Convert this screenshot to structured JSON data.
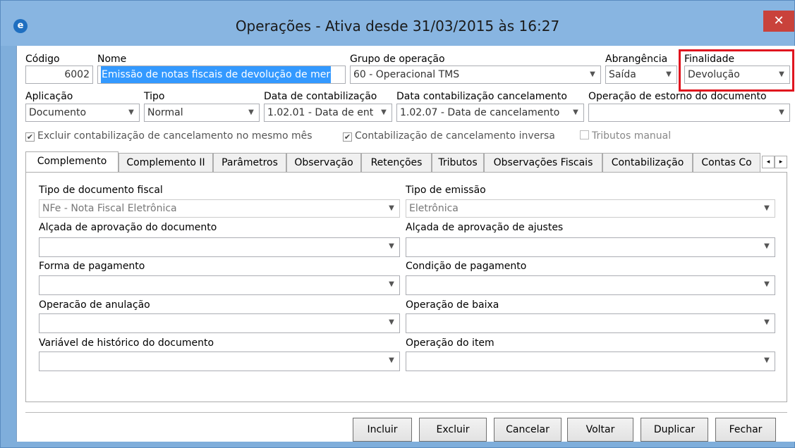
{
  "window": {
    "title": "Operações - Ativa desde 31/03/2015 às 16:27",
    "app_icon_glyph": "e",
    "close_glyph": "✕"
  },
  "header": {
    "codigo": {
      "label": "Código",
      "value": "6002"
    },
    "nome": {
      "label": "Nome",
      "value": "Emissão de notas fiscais de devolução de mer"
    },
    "grupo": {
      "label": "Grupo de operação",
      "value": "60 - Operacional TMS"
    },
    "abrangencia": {
      "label": "Abrangência",
      "value": "Saída"
    },
    "finalidade": {
      "label": "Finalidade",
      "value": "Devolução"
    },
    "aplicacao": {
      "label": "Aplicação",
      "value": "Documento"
    },
    "tipo": {
      "label": "Tipo",
      "value": "Normal"
    },
    "data_contab": {
      "label": "Data de contabilização",
      "value": "1.02.01 - Data de ent"
    },
    "data_cancel": {
      "label": "Data contabilização cancelamento",
      "value": "1.02.07 - Data de cancelamento"
    },
    "estorno": {
      "label": "Operação de estorno do documento",
      "value": ""
    }
  },
  "checkboxes": [
    {
      "label": "Excluir contabilização de cancelamento no mesmo mês",
      "checked": true
    },
    {
      "label": "Contabilização de cancelamento inversa",
      "checked": true
    },
    {
      "label": "Tributos manual",
      "checked": false
    }
  ],
  "tabs": [
    "Complemento",
    "Complemento II",
    "Parâmetros",
    "Observação",
    "Retenções",
    "Tributos",
    "Observações Fiscais",
    "Contabilização",
    "Contas Co"
  ],
  "tab_scroll": {
    "left": "◂",
    "right": "▸"
  },
  "panel": {
    "tipo_doc_fiscal": {
      "label": "Tipo de documento fiscal",
      "value": "NFe - Nota Fiscal Eletrônica"
    },
    "tipo_emissao": {
      "label": "Tipo de emissão",
      "value": "Eletrônica"
    },
    "alcada_doc": {
      "label": "Alçada de aprovação do documento",
      "value": ""
    },
    "alcada_ajustes": {
      "label": "Alçada de aprovação de ajustes",
      "value": ""
    },
    "forma_pagamento": {
      "label": "Forma de pagamento",
      "value": ""
    },
    "condicao_pagamento": {
      "label": "Condição de pagamento",
      "value": ""
    },
    "operacao_anulacao": {
      "label": "Operacão de anulação",
      "value": ""
    },
    "operacao_baixa": {
      "label": "Operação de baixa",
      "value": ""
    },
    "variavel_historico": {
      "label": "Variável de histórico do documento",
      "value": ""
    },
    "operacao_item": {
      "label": "Operação do item",
      "value": ""
    }
  },
  "buttons": {
    "incluir": "Incluir",
    "excluir": "Excluir",
    "cancelar": "Cancelar",
    "voltar": "Voltar",
    "duplicar": "Duplicar",
    "fechar": "Fechar"
  },
  "icons": {
    "dropdown": "▼",
    "check": "✔"
  },
  "colors": {
    "accent_red": "#e0141e",
    "title_bar": "#88b5e1",
    "selection": "#3399ff"
  }
}
